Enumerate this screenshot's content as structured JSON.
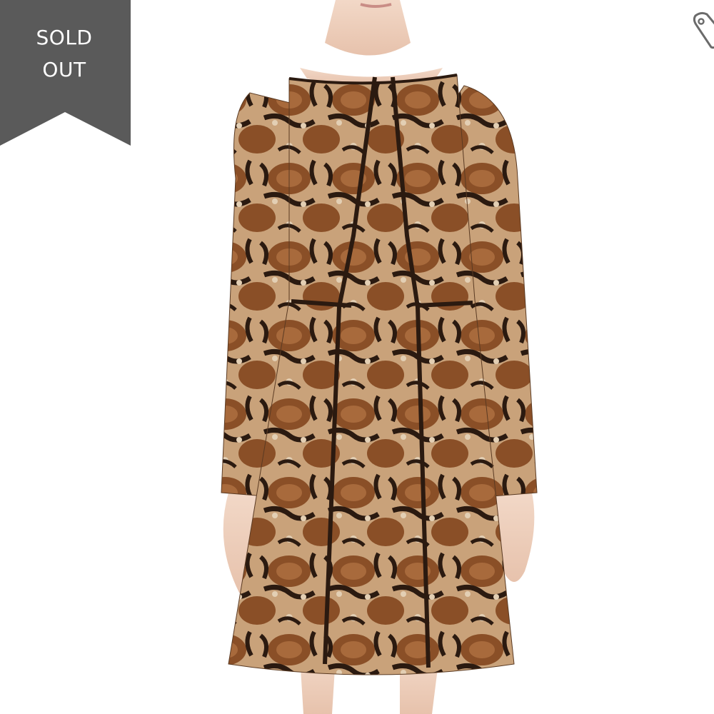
{
  "badge": {
    "line1": "SOLD",
    "line2": "OUT",
    "color": "#5a5a5a",
    "text_color": "#ffffff"
  },
  "product": {
    "image_icon": "snakeskin-print-dress-photo",
    "print_colors": [
      "#8a4f27",
      "#c9a27a",
      "#2b1a10",
      "#e3cfb4",
      "#a86a3c"
    ]
  },
  "wishlist": {
    "icon": "tag-icon"
  }
}
